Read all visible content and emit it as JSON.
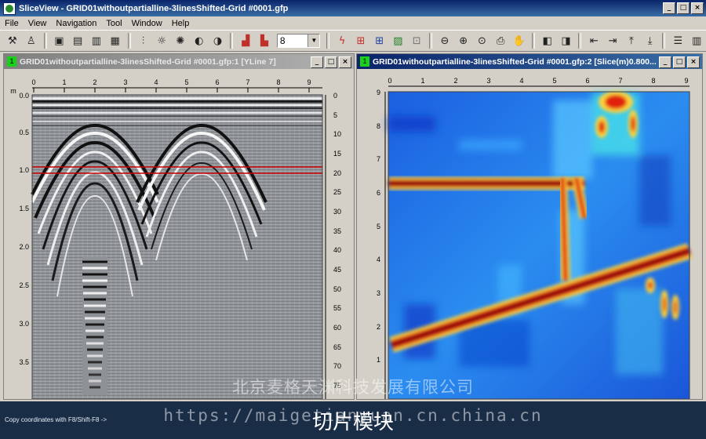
{
  "app": {
    "title": "SliceView - GRID01withoutpartialline-3linesShifted-Grid #0001.gfp",
    "window_buttons": [
      "_",
      "□",
      "×"
    ]
  },
  "menu": [
    "File",
    "View",
    "Navigation",
    "Tool",
    "Window",
    "Help"
  ],
  "toolbar": {
    "combo_value": "8",
    "icons": [
      "tools-icon",
      "person-icon",
      "save-icon",
      "layers-icon",
      "layers-alt-icon",
      "stack-icon",
      "sliders-icon",
      "sun-icon",
      "sun-alt-icon",
      "contrast-icon",
      "contrast-alt-icon",
      "bar-chart-icon",
      "bar-chart-alt-icon",
      "lightning-icon",
      "grid-red-icon",
      "grid-blue-icon",
      "export-icon",
      "fd-icon",
      "zoom-out-icon",
      "zoom-in-icon",
      "zoom-fit-icon",
      "print-icon",
      "hand-icon",
      "cube-icon",
      "cube-alt-icon",
      "first-icon",
      "last-icon",
      "top-icon",
      "bottom-icon",
      "rows-icon",
      "columns-icon"
    ]
  },
  "left_window": {
    "number": "1",
    "title": "GRID01withoutpartialline-3linesShifted-Grid #0001.gfp:1 [YLine 7]",
    "x_ticks": [
      "0",
      "1",
      "2",
      "3",
      "4",
      "5",
      "6",
      "7",
      "8",
      "9"
    ],
    "unit": "m",
    "y_left_ticks": [
      "0.0",
      "0.5",
      "1.0",
      "1.5",
      "2.0",
      "2.5",
      "3.0",
      "3.5"
    ],
    "y_right_ticks": [
      "0",
      "5",
      "10",
      "15",
      "20",
      "25",
      "30",
      "35",
      "40",
      "45",
      "50",
      "55",
      "60",
      "65",
      "70",
      "75"
    ]
  },
  "right_window": {
    "number": "1",
    "title": "GRID01withoutpartialline-3linesShifted-Grid #0001.gfp:2 [Slice(m)0.800...",
    "x_ticks": [
      "0",
      "1",
      "2",
      "3",
      "4",
      "5",
      "6",
      "7",
      "8",
      "9"
    ],
    "y_ticks": [
      "9",
      "8",
      "7",
      "6",
      "5",
      "4",
      "3",
      "2",
      "1"
    ]
  },
  "status": {
    "text": "Copy coordinates with F8/Shift-F8 ->"
  },
  "watermark": {
    "company": "北京麦格天渊科技发展有限公司",
    "url": "https://maigetianyuan.cn.china.cn",
    "caption": "切片模块"
  },
  "colors": {
    "title_active": "#0a246a",
    "title_inactive": "#808080",
    "cut_line": "#cc0000",
    "status_bg": "#1a2d47"
  }
}
